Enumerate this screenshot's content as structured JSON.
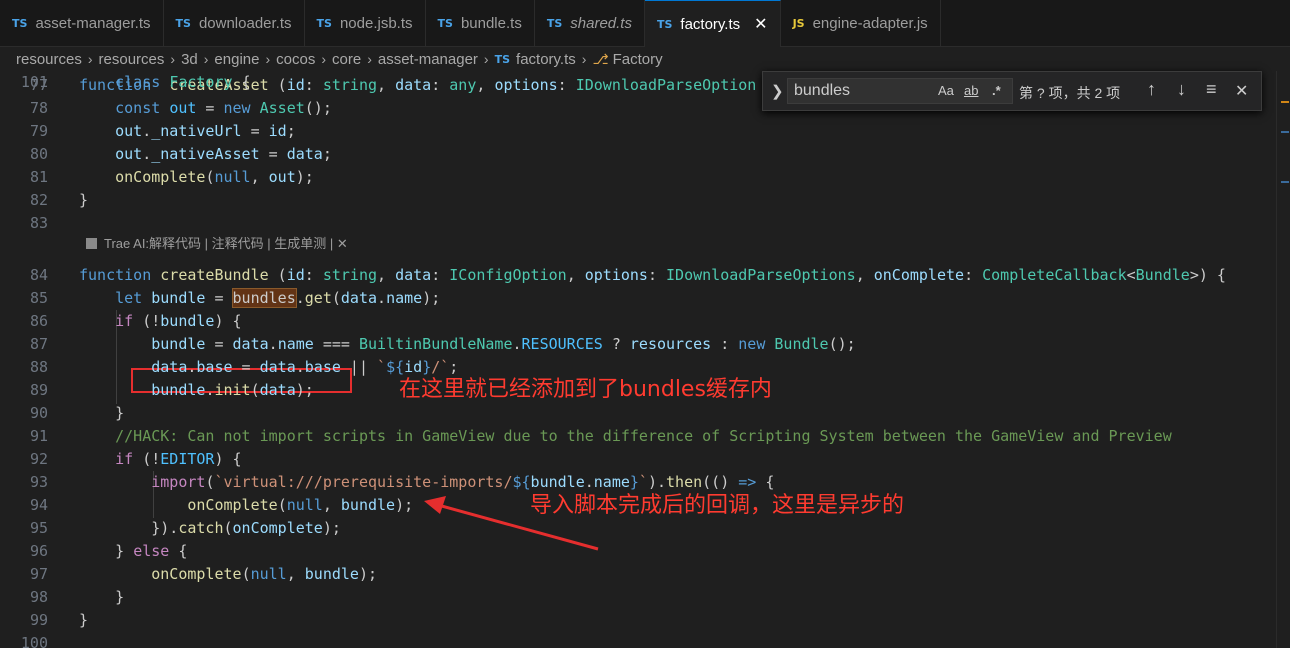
{
  "tabs": [
    {
      "icon": "TS",
      "label": "asset-manager.ts",
      "active": false,
      "italic": false
    },
    {
      "icon": "TS",
      "label": "downloader.ts",
      "active": false,
      "italic": false
    },
    {
      "icon": "TS",
      "label": "node.jsb.ts",
      "active": false,
      "italic": false
    },
    {
      "icon": "TS",
      "label": "bundle.ts",
      "active": false,
      "italic": false
    },
    {
      "icon": "TS",
      "label": "shared.ts",
      "active": false,
      "italic": true
    },
    {
      "icon": "TS",
      "label": "factory.ts",
      "active": true,
      "italic": false,
      "close": "✕"
    },
    {
      "icon": "JS",
      "label": "engine-adapter.js",
      "active": false,
      "italic": false
    }
  ],
  "breadcrumb": {
    "items": [
      "resources",
      "resources",
      "3d",
      "engine",
      "cocos",
      "core",
      "asset-manager"
    ],
    "file_icon": "TS",
    "file": "factory.ts",
    "symbol": "Factory"
  },
  "codelens": "Trae AI:解释代码 | 注释代码 | 生成单测 | ✕",
  "find": {
    "query": "bundles",
    "opt_case": "Aa",
    "opt_word": "ab",
    "opt_regex": ".*",
    "count": "第 ? 项，共 2 项",
    "prev": "↑",
    "next": "↓",
    "selection": "≡",
    "close": "✕"
  },
  "annotations": {
    "cache_note": "在这里就已经添加到了bundles缓存内",
    "async_note": "导入脚本完成后的回调，这里是异步的"
  },
  "lines": [
    {
      "n": "77",
      "tokens": [
        [
          "kw",
          "function"
        ],
        [
          "",
          "  "
        ],
        [
          "fn",
          "createAsset"
        ],
        [
          "",
          " ("
        ],
        [
          "var",
          "id"
        ],
        [
          "",
          ": "
        ],
        [
          "ty",
          "string"
        ],
        [
          "",
          ", "
        ],
        [
          "var",
          "data"
        ],
        [
          "",
          ": "
        ],
        [
          "ty",
          "any"
        ],
        [
          "",
          ", "
        ],
        [
          "var",
          "options"
        ],
        [
          "",
          ": "
        ],
        [
          "ty",
          "IDownloadParseOption"
        ]
      ]
    },
    {
      "n": "78",
      "tokens": [
        [
          "",
          "    "
        ],
        [
          "kw",
          "const"
        ],
        [
          "",
          " "
        ],
        [
          "prop",
          "out"
        ],
        [
          "",
          " = "
        ],
        [
          "kw",
          "new"
        ],
        [
          "",
          " "
        ],
        [
          "ty",
          "Asset"
        ],
        [
          "",
          "();"
        ]
      ]
    },
    {
      "n": "79",
      "tokens": [
        [
          "",
          "    "
        ],
        [
          "var",
          "out"
        ],
        [
          "",
          "."
        ],
        [
          "var",
          "_nativeUrl"
        ],
        [
          "",
          " = "
        ],
        [
          "var",
          "id"
        ],
        [
          "",
          ";"
        ]
      ]
    },
    {
      "n": "80",
      "tokens": [
        [
          "",
          "    "
        ],
        [
          "var",
          "out"
        ],
        [
          "",
          "."
        ],
        [
          "var",
          "_nativeAsset"
        ],
        [
          "",
          " = "
        ],
        [
          "var",
          "data"
        ],
        [
          "",
          ";"
        ]
      ]
    },
    {
      "n": "81",
      "tokens": [
        [
          "",
          "    "
        ],
        [
          "fn",
          "onComplete"
        ],
        [
          "",
          "("
        ],
        [
          "kw",
          "null"
        ],
        [
          "",
          ", "
        ],
        [
          "var",
          "out"
        ],
        [
          "",
          ");"
        ]
      ]
    },
    {
      "n": "82",
      "tokens": [
        [
          "",
          "}"
        ]
      ]
    },
    {
      "n": "83",
      "tokens": []
    },
    {
      "n": "84",
      "tokens": [
        [
          "kw",
          "function"
        ],
        [
          "",
          " "
        ],
        [
          "fn",
          "createBundle"
        ],
        [
          "",
          " ("
        ],
        [
          "var",
          "id"
        ],
        [
          "",
          ": "
        ],
        [
          "ty",
          "string"
        ],
        [
          "",
          ", "
        ],
        [
          "var",
          "data"
        ],
        [
          "",
          ": "
        ],
        [
          "ty",
          "IConfigOption"
        ],
        [
          "",
          ", "
        ],
        [
          "var",
          "options"
        ],
        [
          "",
          ": "
        ],
        [
          "ty",
          "IDownloadParseOptions"
        ],
        [
          "",
          ", "
        ],
        [
          "var",
          "onComplete"
        ],
        [
          "",
          ": "
        ],
        [
          "ty",
          "CompleteCallback"
        ],
        [
          "",
          "<"
        ],
        [
          "ty",
          "Bundle"
        ],
        [
          "",
          ">) {"
        ]
      ]
    },
    {
      "n": "85",
      "tokens": [
        [
          "",
          "    "
        ],
        [
          "kw",
          "let"
        ],
        [
          "",
          " "
        ],
        [
          "var",
          "bundle"
        ],
        [
          "",
          " = "
        ],
        [
          "hl",
          "bundles"
        ],
        [
          "",
          "."
        ],
        [
          "fn",
          "get"
        ],
        [
          "",
          "("
        ],
        [
          "var",
          "data"
        ],
        [
          "",
          "."
        ],
        [
          "var",
          "name"
        ],
        [
          "",
          ");"
        ]
      ]
    },
    {
      "n": "86",
      "tokens": [
        [
          "",
          "    "
        ],
        [
          "ctl",
          "if"
        ],
        [
          "",
          " (!"
        ],
        [
          "var",
          "bundle"
        ],
        [
          "",
          ") {"
        ]
      ]
    },
    {
      "n": "87",
      "tokens": [
        [
          "",
          "        "
        ],
        [
          "var",
          "bundle"
        ],
        [
          "",
          " = "
        ],
        [
          "var",
          "data"
        ],
        [
          "",
          "."
        ],
        [
          "var",
          "name"
        ],
        [
          "",
          " === "
        ],
        [
          "ty",
          "BuiltinBundleName"
        ],
        [
          "",
          "."
        ],
        [
          "prop",
          "RESOURCES"
        ],
        [
          "",
          " ? "
        ],
        [
          "var",
          "resources"
        ],
        [
          "",
          " : "
        ],
        [
          "kw",
          "new"
        ],
        [
          "",
          " "
        ],
        [
          "ty",
          "Bundle"
        ],
        [
          "",
          "();"
        ]
      ]
    },
    {
      "n": "88",
      "tokens": [
        [
          "",
          "        "
        ],
        [
          "var",
          "data"
        ],
        [
          "",
          "."
        ],
        [
          "var",
          "base"
        ],
        [
          "",
          " = "
        ],
        [
          "var",
          "data"
        ],
        [
          "",
          "."
        ],
        [
          "var",
          "base"
        ],
        [
          "",
          " || "
        ],
        [
          "str",
          "`"
        ],
        [
          "kw",
          "${"
        ],
        [
          "var",
          "id"
        ],
        [
          "kw",
          "}"
        ],
        [
          "str",
          "/`"
        ],
        [
          "",
          ";"
        ]
      ]
    },
    {
      "n": "89",
      "tokens": [
        [
          "",
          "        "
        ],
        [
          "var",
          "bundle"
        ],
        [
          "",
          "."
        ],
        [
          "fn",
          "init"
        ],
        [
          "",
          "("
        ],
        [
          "var",
          "data"
        ],
        [
          "",
          ");"
        ]
      ]
    },
    {
      "n": "90",
      "tokens": [
        [
          "",
          "    }"
        ]
      ]
    },
    {
      "n": "91",
      "tokens": [
        [
          "",
          "    "
        ],
        [
          "cm",
          "//HACK: Can not import scripts in GameView due to the difference of Scripting System between the GameView and Preview"
        ]
      ]
    },
    {
      "n": "92",
      "tokens": [
        [
          "",
          "    "
        ],
        [
          "ctl",
          "if"
        ],
        [
          "",
          " (!"
        ],
        [
          "prop",
          "EDITOR"
        ],
        [
          "",
          ") {"
        ]
      ]
    },
    {
      "n": "93",
      "tokens": [
        [
          "",
          "        "
        ],
        [
          "ctl",
          "import"
        ],
        [
          "",
          "("
        ],
        [
          "str",
          "`virtual:///prerequisite-imports/"
        ],
        [
          "kw",
          "${"
        ],
        [
          "var",
          "bundle"
        ],
        [
          "",
          "."
        ],
        [
          "var",
          "name"
        ],
        [
          "kw",
          "}"
        ],
        [
          "str",
          "`"
        ],
        [
          "",
          ")."
        ],
        [
          "fn",
          "then"
        ],
        [
          "",
          "(() "
        ],
        [
          "kw",
          "=>"
        ],
        [
          "",
          " {"
        ]
      ]
    },
    {
      "n": "94",
      "tokens": [
        [
          "",
          "            "
        ],
        [
          "fn",
          "onComplete"
        ],
        [
          "",
          "("
        ],
        [
          "kw",
          "null"
        ],
        [
          "",
          ", "
        ],
        [
          "var",
          "bundle"
        ],
        [
          "",
          ");"
        ]
      ]
    },
    {
      "n": "95",
      "tokens": [
        [
          "",
          "        })."
        ],
        [
          "fn",
          "catch"
        ],
        [
          "",
          "("
        ],
        [
          "var",
          "onComplete"
        ],
        [
          "",
          ");"
        ]
      ]
    },
    {
      "n": "96",
      "tokens": [
        [
          "",
          "    } "
        ],
        [
          "ctl",
          "else"
        ],
        [
          "",
          " {"
        ]
      ]
    },
    {
      "n": "97",
      "tokens": [
        [
          "",
          "        "
        ],
        [
          "fn",
          "onComplete"
        ],
        [
          "",
          "("
        ],
        [
          "kw",
          "null"
        ],
        [
          "",
          ", "
        ],
        [
          "var",
          "bundle"
        ],
        [
          "",
          ");"
        ]
      ]
    },
    {
      "n": "98",
      "tokens": [
        [
          "",
          "    }"
        ]
      ]
    },
    {
      "n": "99",
      "tokens": [
        [
          "",
          "}"
        ]
      ]
    },
    {
      "n": "100",
      "tokens": []
    },
    {
      "n": "101",
      "tokens": [
        [
          "",
          "    "
        ],
        [
          "kw",
          "class"
        ],
        [
          "",
          " "
        ],
        [
          "ty",
          "Factory"
        ],
        [
          "",
          " {"
        ]
      ]
    }
  ]
}
